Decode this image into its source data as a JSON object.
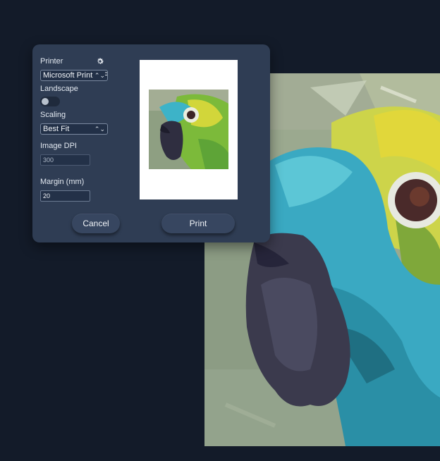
{
  "dialog": {
    "printer_label": "Printer",
    "printer_value": "Microsoft Print to PDF",
    "landscape_label": "Landscape",
    "landscape_on": false,
    "scaling_label": "Scaling",
    "scaling_value": "Best Fit",
    "dpi_label": "Image DPI",
    "dpi_value": "300",
    "margin_label": "Margin (mm)",
    "margin_value": "20",
    "cancel_label": "Cancel",
    "print_label": "Print"
  },
  "icons": {
    "settings": "gear-icon",
    "select_arrows": "chevron-updown-icon"
  },
  "colors": {
    "background": "#131b29",
    "dialog": "#2f3d54",
    "button": "#374660"
  }
}
